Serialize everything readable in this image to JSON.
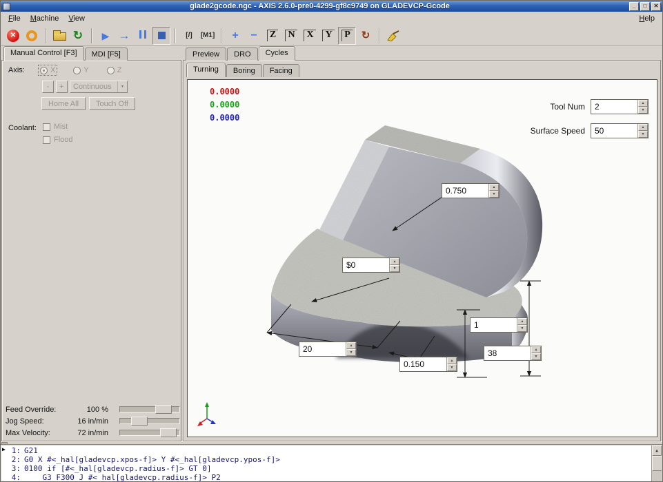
{
  "window": {
    "title": "glade2gcode.ngc - AXIS 2.6.0-pre0-4299-gf8c9749 on GLADEVCP-Gcode"
  },
  "icons": {
    "minimize": "_",
    "maximize": "□",
    "close": "✕",
    "estop": "✕",
    "reload": "↻",
    "run": "▶",
    "step": "→",
    "block_delete": "[/]",
    "optional_stop": "[M1]",
    "zoom_in": "+",
    "zoom_out": "−",
    "view_z": "Z",
    "view_z_rot": "N",
    "view_x": "X",
    "view_y": "Y",
    "view_p": "P",
    "rotate": "↻",
    "combo_arrow": "▼",
    "spin_up": "▲",
    "spin_down": "▼",
    "scroll_up": "▲",
    "line_marker": "▶"
  },
  "menu": {
    "items": [
      {
        "label": "File"
      },
      {
        "label": "Machine"
      },
      {
        "label": "View"
      }
    ],
    "help": "Help"
  },
  "manual": {
    "tabs": [
      {
        "label": "Manual Control [F3]"
      },
      {
        "label": "MDI [F5]"
      }
    ],
    "axis_label": "Axis:",
    "axes": [
      {
        "label": "X"
      },
      {
        "label": "Y"
      },
      {
        "label": "Z"
      }
    ],
    "jog_minus": "-",
    "jog_plus": "+",
    "jog_mode": "Continuous",
    "home_all": "Home All",
    "touch_off": "Touch Off",
    "coolant_label": "Coolant:",
    "mist": "Mist",
    "flood": "Flood",
    "sliders": [
      {
        "label": "Feed Override:",
        "value": "100 %"
      },
      {
        "label": "Jog Speed:",
        "value": "16 in/min"
      },
      {
        "label": "Max Velocity:",
        "value": "72 in/min"
      }
    ]
  },
  "cycles": {
    "tabs": [
      "Preview",
      "DRO",
      "Cycles"
    ],
    "subtabs": [
      "Turning",
      "Boring",
      "Facing"
    ],
    "dro": {
      "x": "0.0000",
      "y": "0.0000",
      "z": "0.0000"
    },
    "tool_num": {
      "label": "Tool Num",
      "value": "2"
    },
    "surface_speed": {
      "label": "Surface Speed",
      "value": "50"
    },
    "spinboxes": [
      {
        "value": "0.750"
      },
      {
        "value": "$0"
      },
      {
        "value": "20"
      },
      {
        "value": "0.150"
      },
      {
        "value": "1"
      },
      {
        "value": "38"
      }
    ]
  },
  "gcode": {
    "lines": [
      {
        "num": "1:",
        "code": "G21"
      },
      {
        "num": "2:",
        "code": "G0 X #<_hal[gladevcp.xpos-f]> Y #<_hal[gladevcp.ypos-f]>"
      },
      {
        "num": "3:",
        "code": "0100 if [#<_hal[gladevcp.radius-f]> GT 0]"
      },
      {
        "num": "4:",
        "code": "    G3 F300 J #<_hal[gladevcp.radius-f]> P2"
      }
    ]
  },
  "colors": {
    "titlebar_top": "#6f9bd8",
    "titlebar_bottom": "#1c4ba0",
    "dro_x": "#cc1111",
    "dro_y": "#11aa11",
    "dro_z": "#2222cc",
    "gcode_text": "#16166e"
  }
}
